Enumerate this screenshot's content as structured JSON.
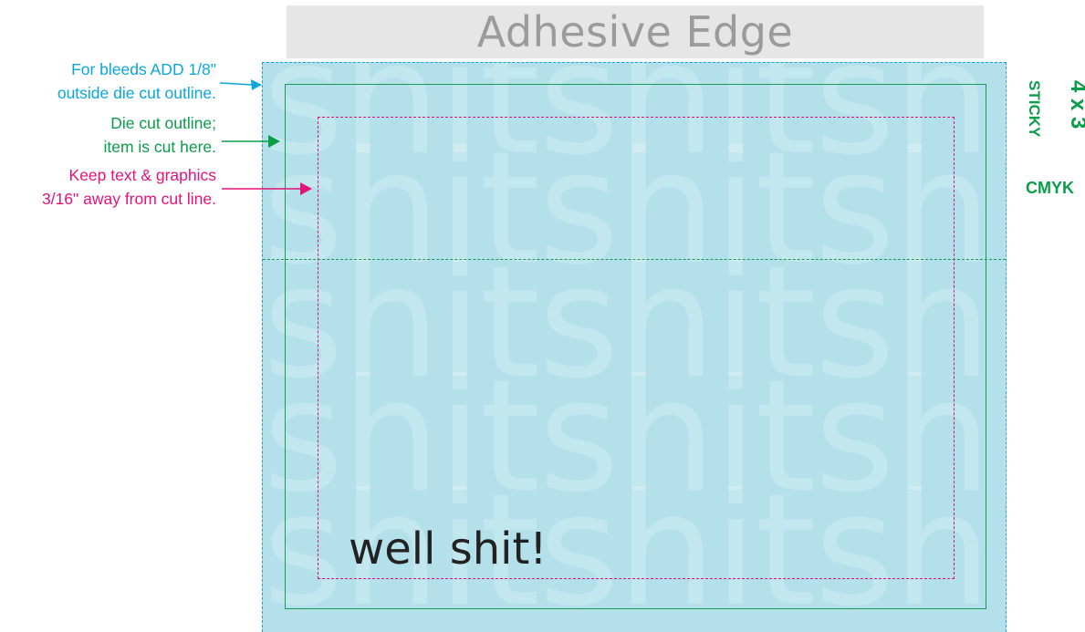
{
  "adhesive": {
    "label": "Adhesive Edge"
  },
  "notes": {
    "bleed": {
      "line1": "For bleeds ADD 1/8\"",
      "line2": "outside die cut outline.",
      "color": "#0aa6dc"
    },
    "die": {
      "line1": "Die cut outline;",
      "line2": "item is cut here.",
      "color": "#0a9d4a"
    },
    "safe": {
      "line1": "Keep text & graphics",
      "line2": "3/16\" away from cut line.",
      "color": "#e5127a"
    }
  },
  "artboard": {
    "background": "#b3e0ea",
    "watermark": "shitshitshi",
    "text": "well shit!"
  },
  "spec": {
    "size": "4 x 3",
    "type": "STICKY",
    "color_mode": "CMYK",
    "color": "#0a9d4a"
  }
}
